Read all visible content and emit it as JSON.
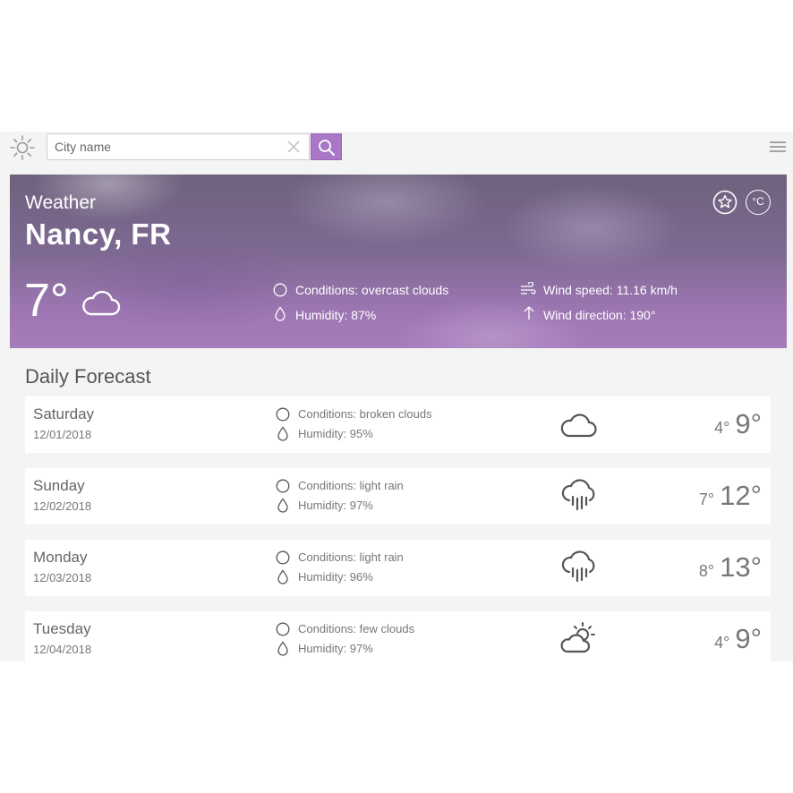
{
  "search": {
    "placeholder": "City name"
  },
  "hero": {
    "label": "Weather",
    "city": "Nancy, FR",
    "temperature": "7°",
    "conditions": "Conditions: overcast clouds",
    "humidity": "Humidity: 87%",
    "wind_speed": "Wind speed: 11.16 km/h",
    "wind_direction": "Wind direction: 190°",
    "unit_button": "°C",
    "weather_icon": "cloud-icon"
  },
  "forecast": {
    "title": "Daily Forecast",
    "days": [
      {
        "day": "Saturday",
        "date": "12/01/2018",
        "conditions": "Conditions: broken clouds",
        "humidity": "Humidity: 95%",
        "min": "4°",
        "max": "9°",
        "icon": "cloud-icon"
      },
      {
        "day": "Sunday",
        "date": "12/02/2018",
        "conditions": "Conditions: light rain",
        "humidity": "Humidity: 97%",
        "min": "7°",
        "max": "12°",
        "icon": "rain-icon"
      },
      {
        "day": "Monday",
        "date": "12/03/2018",
        "conditions": "Conditions: light rain",
        "humidity": "Humidity: 96%",
        "min": "8°",
        "max": "13°",
        "icon": "rain-icon"
      },
      {
        "day": "Tuesday",
        "date": "12/04/2018",
        "conditions": "Conditions: few clouds",
        "humidity": "Humidity: 97%",
        "min": "4°",
        "max": "9°",
        "icon": "sun-cloud-icon"
      }
    ]
  },
  "colors": {
    "accent": "#a977c5",
    "background": "#f4f4f4",
    "card": "#ffffff",
    "text": "#555555"
  }
}
